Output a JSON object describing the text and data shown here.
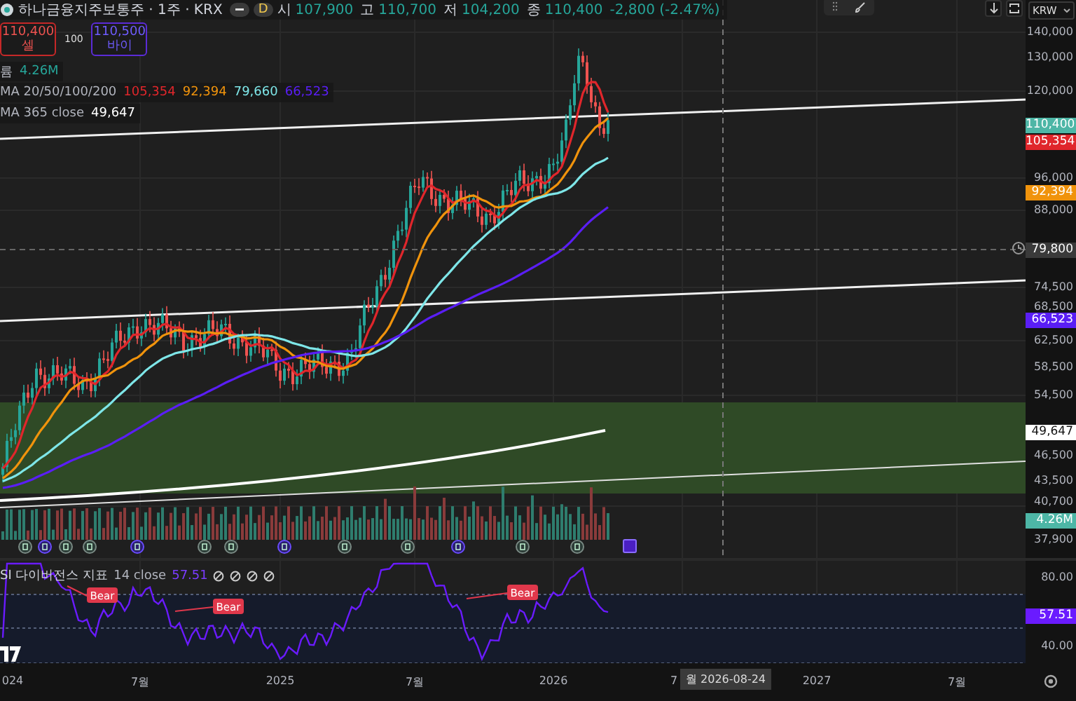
{
  "header": {
    "symbol": "하나금융지주보통주 · 1주 · KRX",
    "interval": "D",
    "ohlc": [
      {
        "label": "시",
        "value": "107,900"
      },
      {
        "label": "고",
        "value": "110,700"
      },
      {
        "label": "저",
        "value": "104,200"
      },
      {
        "label": "종",
        "value": "110,400"
      }
    ],
    "change": "-2,800 (-2.47%)"
  },
  "trade": {
    "sell": {
      "price": "110,400",
      "label": "셀"
    },
    "spread": "100",
    "buy": {
      "price": "110,500",
      "label": "바이"
    }
  },
  "indicators": [
    {
      "name": "륨",
      "values": [
        {
          "text": "4.26M",
          "color": "#26a69a"
        }
      ]
    },
    {
      "name": "MA 20/50/100/200",
      "values": [
        {
          "text": "105,354",
          "color": "#e0262b"
        },
        {
          "text": "92,394",
          "color": "#f0930c"
        },
        {
          "text": "79,660",
          "color": "#7ee6e8"
        },
        {
          "text": "66,523",
          "color": "#5a1ef5"
        }
      ]
    },
    {
      "name": "MA 365 close",
      "values": [
        {
          "text": "49,647",
          "color": "#ffffff"
        }
      ]
    }
  ],
  "toolbar": {
    "currency": "KRW"
  },
  "price_axis": {
    "ticks": [
      "140,000",
      "130,000",
      "120,000",
      "96,000",
      "88,000",
      "74,500",
      "68,500",
      "62,500",
      "58,500",
      "54,500",
      "46,500",
      "43,500",
      "40,700",
      "37,900"
    ],
    "badges": [
      {
        "text": "110,400",
        "color": "#4db6a6"
      },
      {
        "text": "105,354",
        "color": "#e0262b"
      },
      {
        "text": "92,394",
        "color": "#f0930c"
      },
      {
        "text": "79,800",
        "color": "#3a3a3a"
      },
      {
        "text": "66,523",
        "color": "#5a1ef5"
      },
      {
        "text": "49,647",
        "color": "#ffffff"
      },
      {
        "text": "4.26M",
        "color": "#4db6a6"
      }
    ]
  },
  "rsi": {
    "name": "SI 다이버전스 지표",
    "params": "14 close",
    "value": "57.51",
    "signals": [
      {
        "label": "Bear"
      },
      {
        "label": "Bear"
      },
      {
        "label": "Bear"
      }
    ],
    "ticks": [
      "80.00",
      "40.00"
    ],
    "badge": "57.51"
  },
  "time_axis": {
    "labels": [
      "024",
      "7월",
      "2025",
      "7월",
      "2026",
      "7",
      "2027",
      "7월"
    ],
    "cursor": "월 2026-08-24"
  }
}
